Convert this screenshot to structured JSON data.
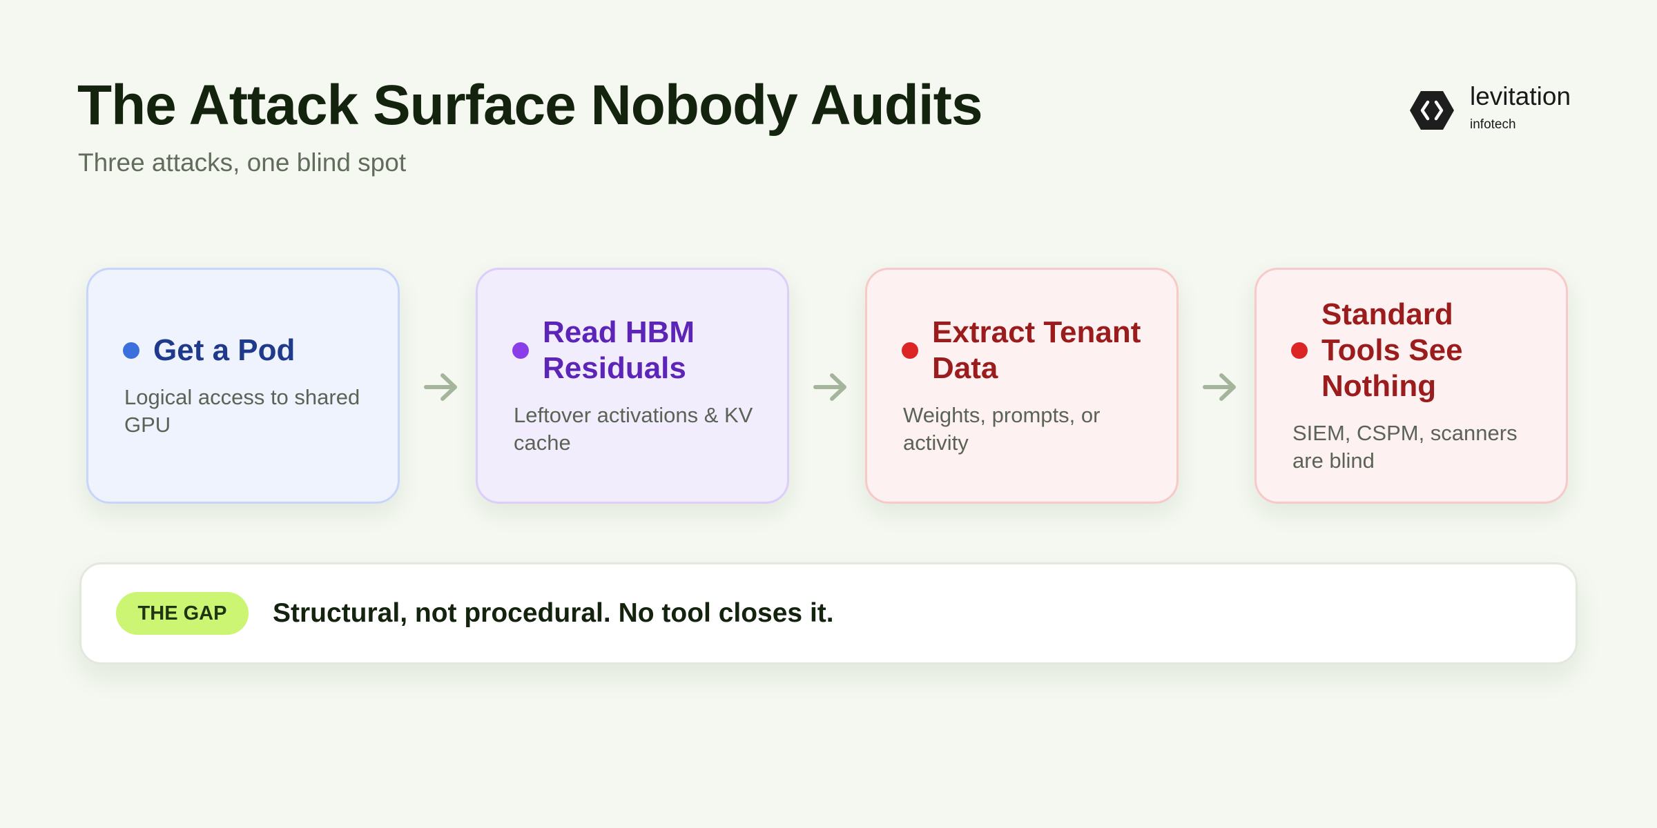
{
  "header": {
    "title": "The Attack Surface Nobody Audits",
    "subtitle": "Three attacks, one blind spot"
  },
  "logo": {
    "name": "levitation",
    "sub": "infotech",
    "icon": "code-hexagon-icon"
  },
  "steps": [
    {
      "title": "Get a Pod",
      "desc": "Logical access to shared GPU",
      "dot_color": "#3b6fdc",
      "title_color": "#1f3a8a",
      "bg": "#eef3fe",
      "border": "#c6d6fb"
    },
    {
      "title": "Read HBM Residuals",
      "desc": "Leftover activations & KV cache",
      "dot_color": "#8a3ee8",
      "title_color": "#5d24b8",
      "bg": "#f2edfd",
      "border": "#dccdfb"
    },
    {
      "title": "Extract Tenant Data",
      "desc": "Weights, prompts, or activity",
      "dot_color": "#dc2626",
      "title_color": "#9b1c1c",
      "bg": "#fef1f1",
      "border": "#f8c9c9"
    },
    {
      "title": "Standard Tools See Nothing",
      "desc": "SIEM, CSPM, scanners are blind",
      "dot_color": "#dc2626",
      "title_color": "#9b1c1c",
      "bg": "#fef1f1",
      "border": "#f8c9c9"
    }
  ],
  "arrow_color": "#a5b59b",
  "gap": {
    "badge": "THE GAP",
    "text": "Structural, not procedural. No tool closes it."
  }
}
